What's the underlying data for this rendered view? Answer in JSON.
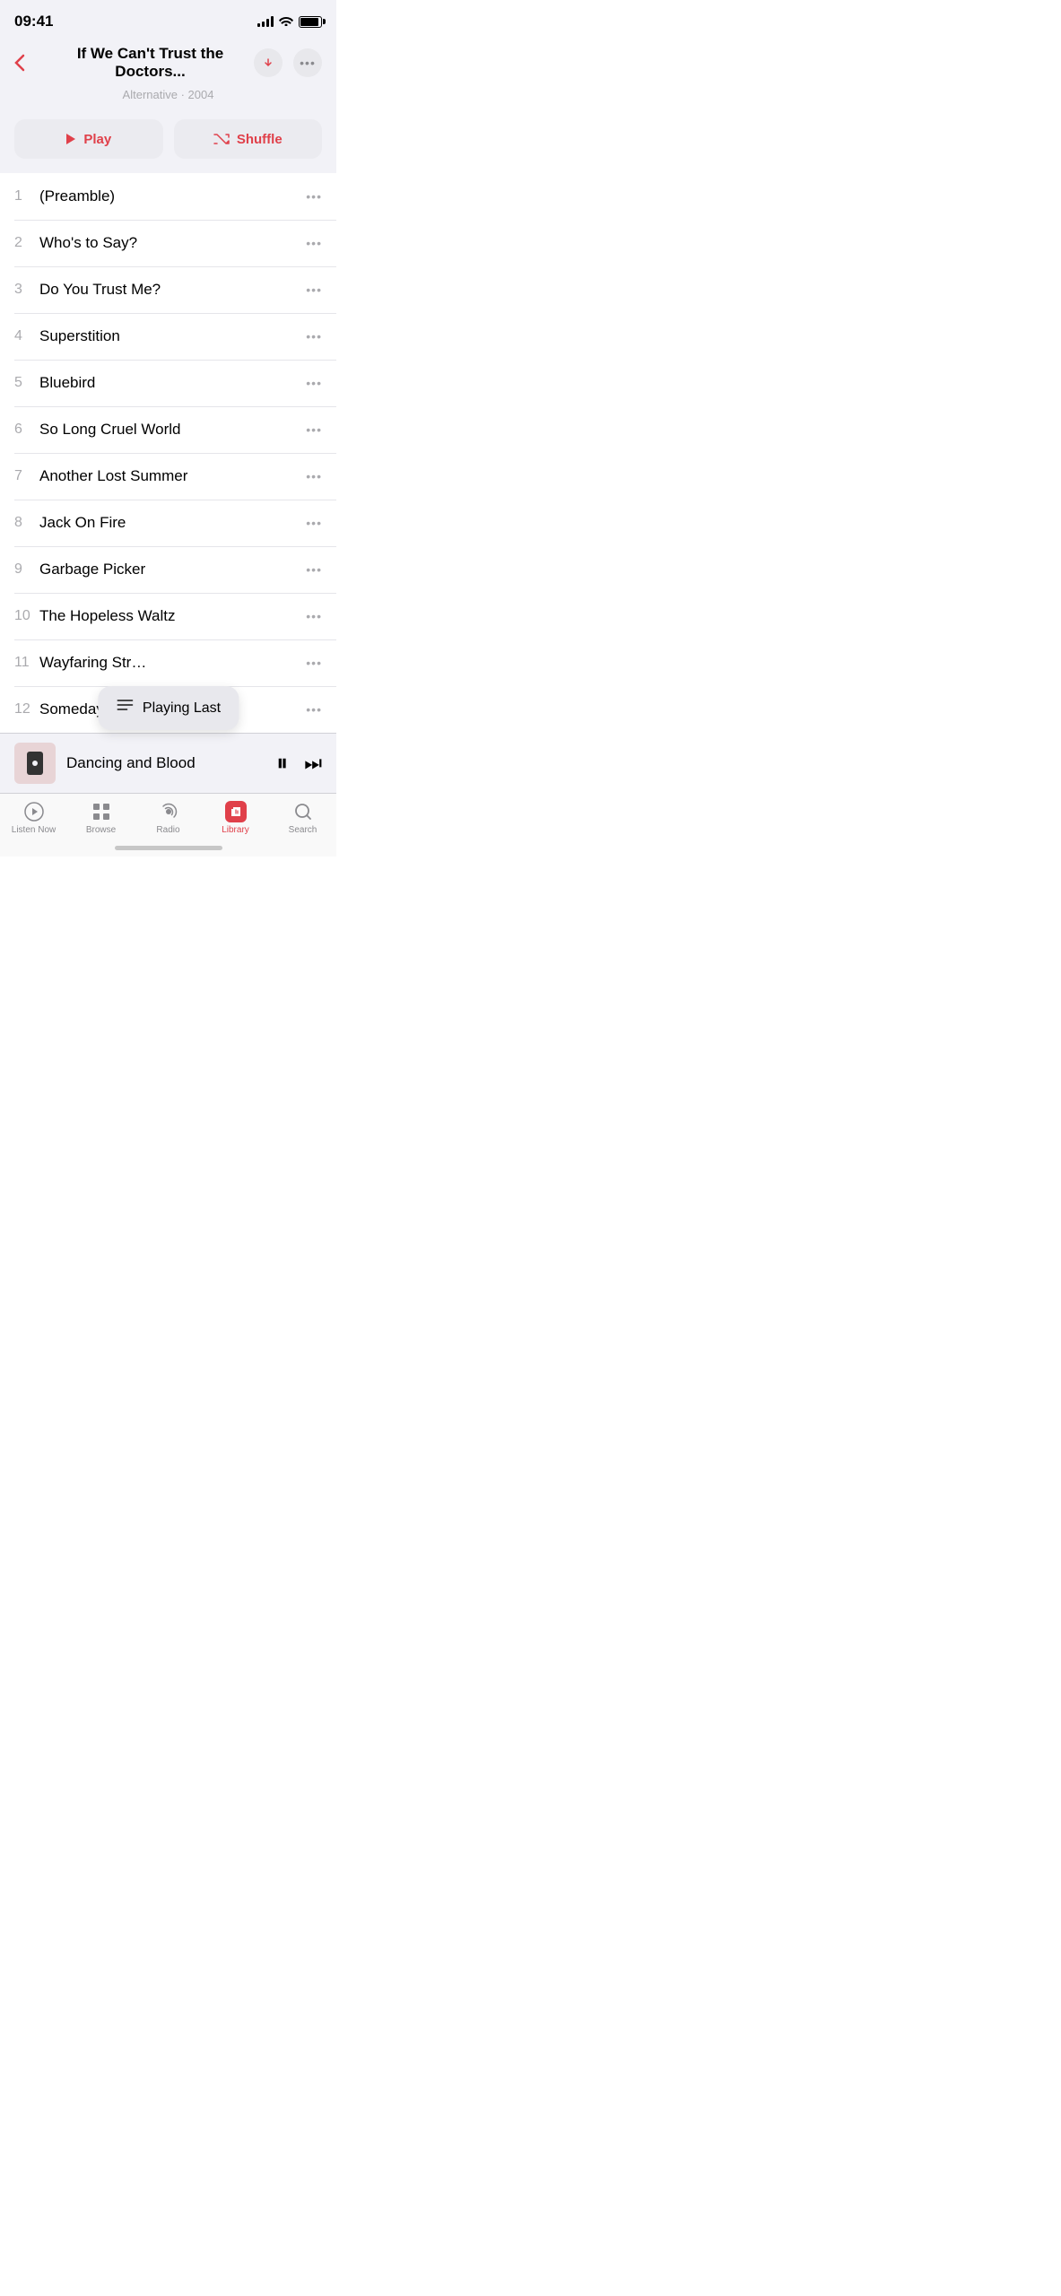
{
  "statusBar": {
    "time": "09:41"
  },
  "header": {
    "title": "If We Can't Trust the Doctors...",
    "backLabel": "‹",
    "subtitle": "Alternative · 2004"
  },
  "actions": {
    "playLabel": "Play",
    "shuffleLabel": "Shuffle"
  },
  "tracks": [
    {
      "num": "1",
      "name": "(Preamble)"
    },
    {
      "num": "2",
      "name": "Who's to Say?"
    },
    {
      "num": "3",
      "name": "Do You Trust Me?"
    },
    {
      "num": "4",
      "name": "Superstition"
    },
    {
      "num": "5",
      "name": "Bluebird"
    },
    {
      "num": "6",
      "name": "So Long Cruel World"
    },
    {
      "num": "7",
      "name": "Another Lost Summer"
    },
    {
      "num": "8",
      "name": "Jack On Fire"
    },
    {
      "num": "9",
      "name": "Garbage Picker"
    },
    {
      "num": "10",
      "name": "The Hopeless Waltz"
    },
    {
      "num": "11",
      "name": "Wayfaring Str…"
    },
    {
      "num": "12",
      "name": "Someday"
    }
  ],
  "nowPlaying": {
    "title": "Dancing and Blood"
  },
  "tooltip": {
    "text": "Playing Last"
  },
  "tabs": [
    {
      "label": "Listen Now",
      "icon": "▶",
      "active": false
    },
    {
      "label": "Browse",
      "icon": "⊞",
      "active": false
    },
    {
      "label": "Radio",
      "icon": "◉",
      "active": false
    },
    {
      "label": "Library",
      "icon": "♪",
      "active": true
    },
    {
      "label": "Search",
      "icon": "⌕",
      "active": false
    }
  ]
}
